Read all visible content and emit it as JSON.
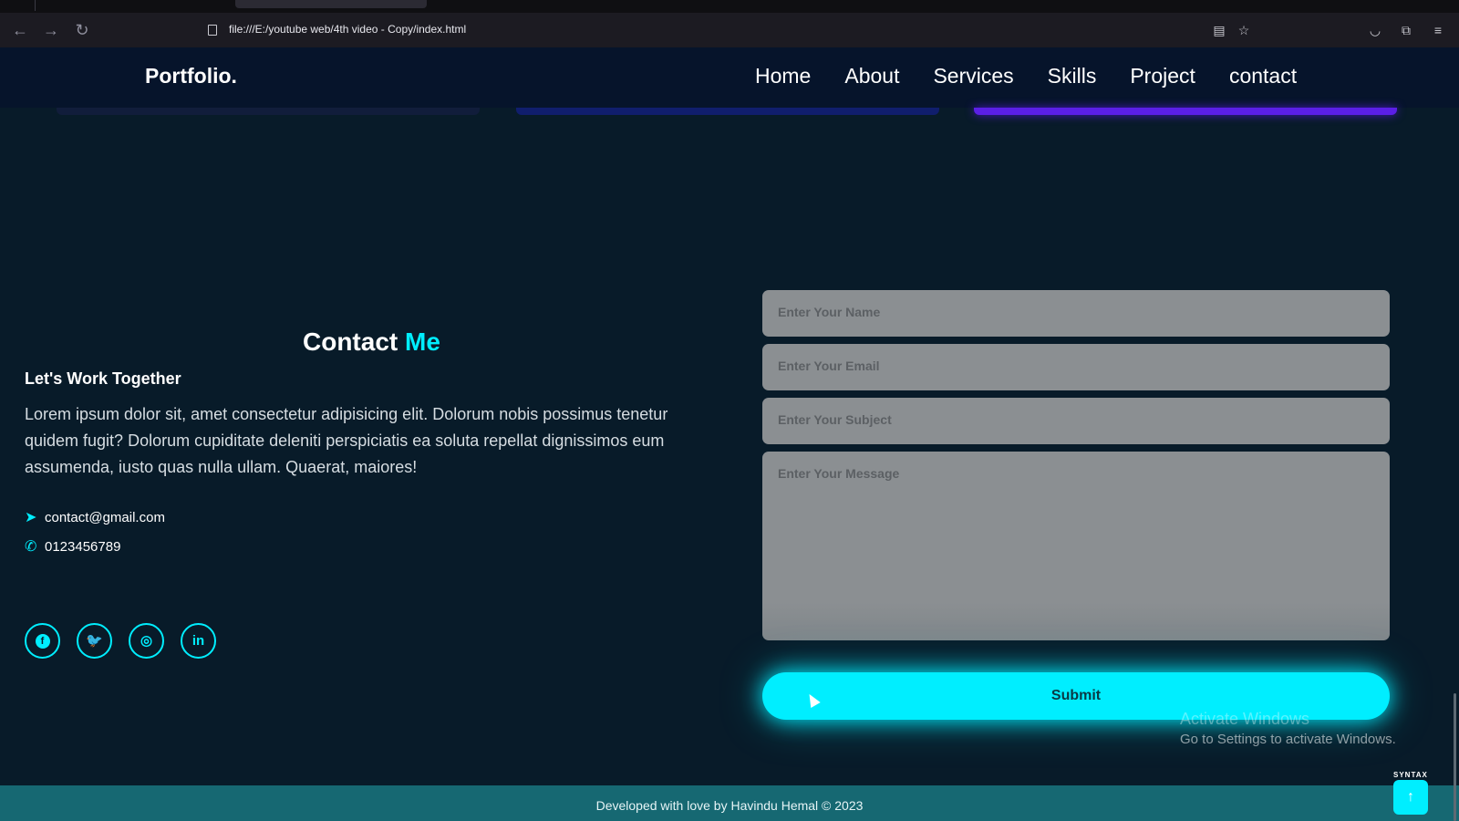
{
  "browser": {
    "url": "file:///E:/youtube web/4th video - Copy/index.html",
    "icons": {
      "back": "arrow-left-icon",
      "forward": "arrow-right-icon",
      "reload": "reload-icon",
      "reader": "reader-view-icon",
      "bookmark": "star-icon",
      "pocket": "pocket-icon",
      "extensions": "extensions-icon",
      "menu": "hamburger-menu-icon"
    }
  },
  "header": {
    "logo": "Portfolio.",
    "nav": [
      "Home",
      "About",
      "Services",
      "Skills",
      "Project",
      "contact"
    ]
  },
  "contact": {
    "title_main": "Contact",
    "title_accent": "Me",
    "subheading": "Let's Work Together",
    "description": "Lorem ipsum dolor sit, amet consectetur adipisicing elit. Dolorum nobis possimus tenetur quidem fugit? Dolorum cupiditate deleniti perspiciatis ea soluta repellat dignissimos eum assumenda, iusto quas nulla ullam. Quaerat, maiores!",
    "email": "contact@gmail.com",
    "phone": "0123456789",
    "socials": [
      "facebook-icon",
      "twitter-icon",
      "instagram-icon",
      "linkedin-icon"
    ]
  },
  "form": {
    "name_placeholder": "Enter Your Name",
    "email_placeholder": "Enter Your Email",
    "subject_placeholder": "Enter Your Subject",
    "message_placeholder": "Enter Your Message",
    "submit_label": "Submit"
  },
  "windows": {
    "activate_title": "Activate Windows",
    "activate_sub": "Go to Settings to activate Windows."
  },
  "footer": {
    "text": "Developed with love by Havindu Hemal © 2023"
  },
  "watermark": "SYNTAX",
  "colors": {
    "accent": "#00eeff",
    "background": "#081b29",
    "header": "#06142b",
    "footer": "#166872",
    "purple": "#5b1fe6"
  }
}
